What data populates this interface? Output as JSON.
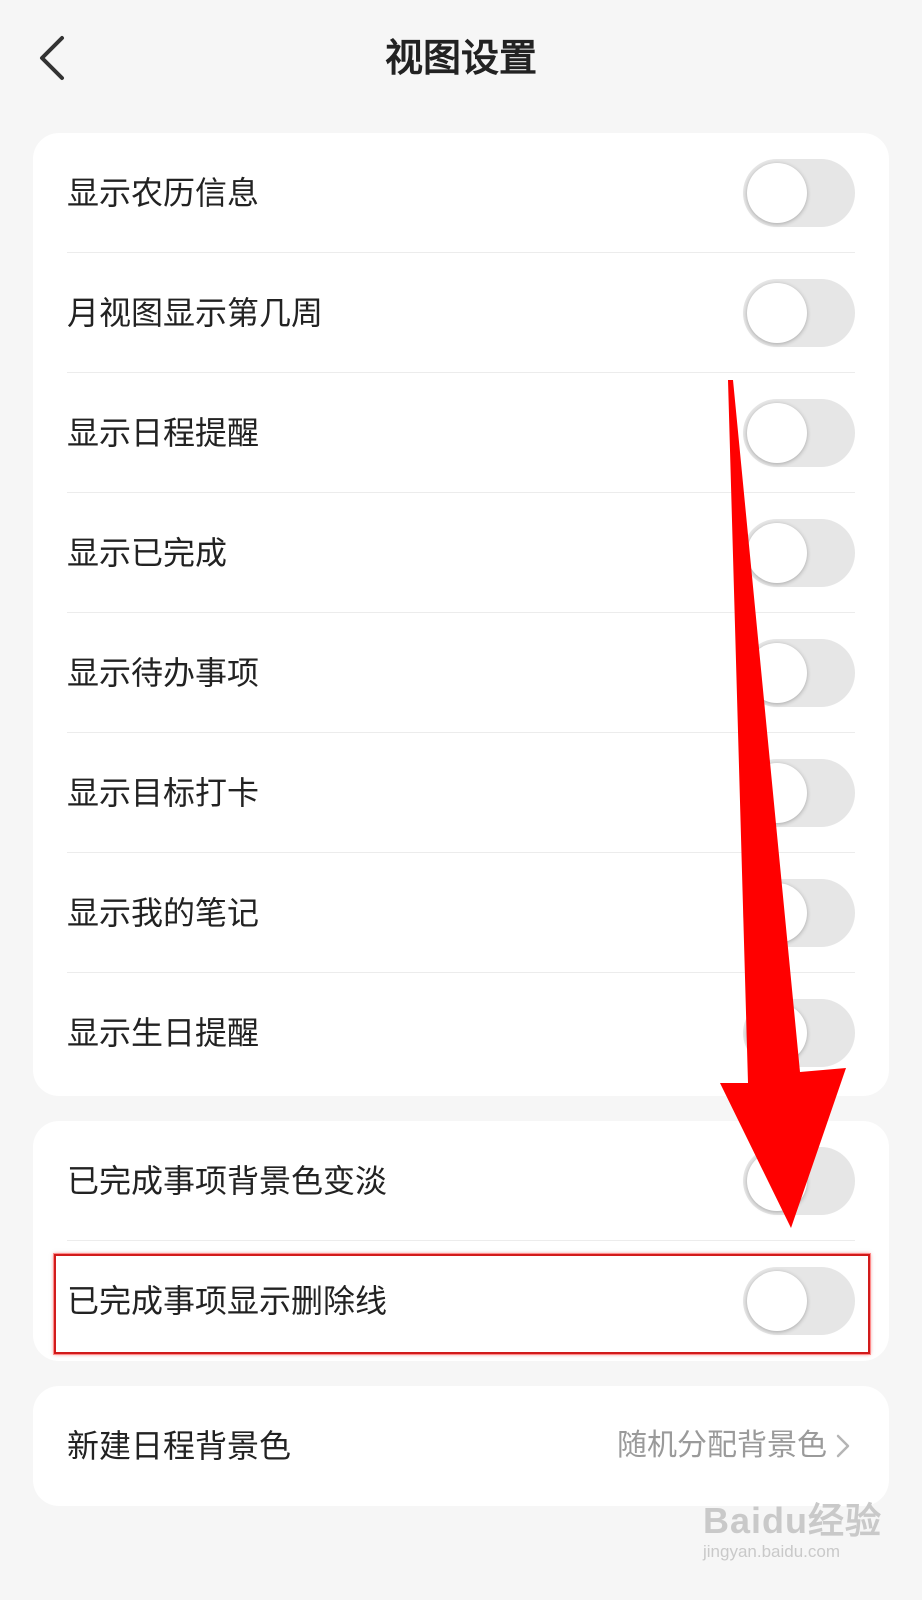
{
  "header": {
    "title": "视图设置",
    "back_icon": "chevron-left-icon"
  },
  "card1": {
    "items": [
      {
        "label": "显示农历信息",
        "enabled": false
      },
      {
        "label": "月视图显示第几周",
        "enabled": false
      },
      {
        "label": "显示日程提醒",
        "enabled": false
      },
      {
        "label": "显示已完成",
        "enabled": false
      },
      {
        "label": "显示待办事项",
        "enabled": false
      },
      {
        "label": "显示目标打卡",
        "enabled": false
      },
      {
        "label": "显示我的笔记",
        "enabled": false
      },
      {
        "label": "显示生日提醒",
        "enabled": false
      }
    ]
  },
  "card2": {
    "items": [
      {
        "label": "已完成事项背景色变淡",
        "enabled": false
      },
      {
        "label": "已完成事项显示删除线",
        "enabled": false
      }
    ]
  },
  "card3": {
    "label": "新建日程背景色",
    "value": "随机分配背景色",
    "icon": "chevron-right-icon"
  },
  "annotation": {
    "arrow_color": "#ff0000",
    "highlight_color": "#d11a1a",
    "highlighted_item": "已完成事项显示删除线"
  },
  "watermark": {
    "main": "Baidu经验",
    "sub": "jingyan.baidu.com"
  },
  "colors": {
    "background": "#f6f6f6",
    "card": "#ffffff",
    "toggle_off": "#e6e6e6",
    "text": "#222222",
    "secondary_text": "#9a9a9a"
  }
}
